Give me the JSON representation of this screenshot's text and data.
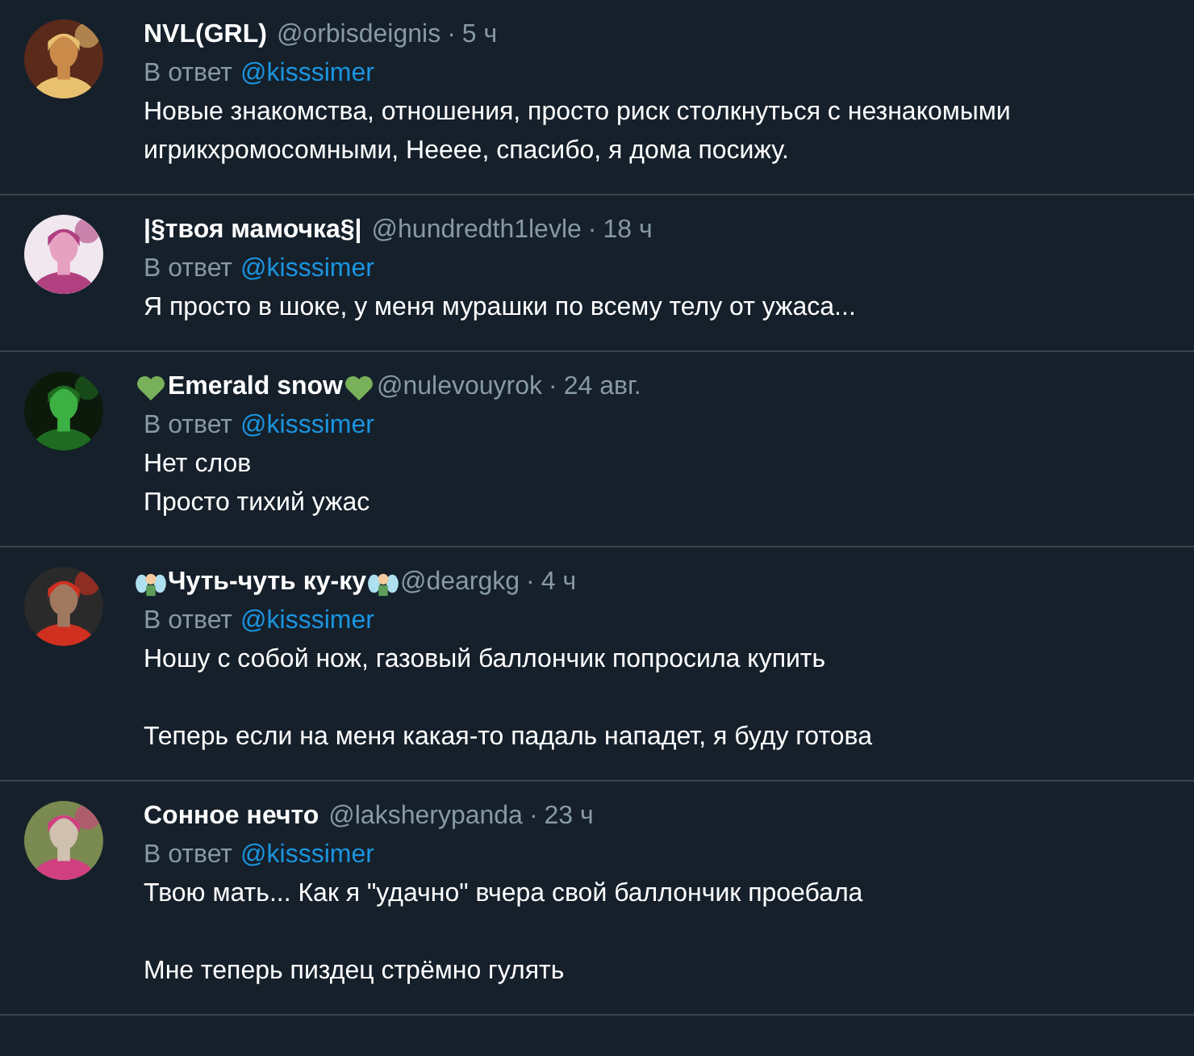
{
  "replies": [
    {
      "kind": "plain",
      "name": "NVL(GRL)",
      "handle": "@orbisdeignis",
      "separator": "·",
      "time": "5 ч",
      "reply_label": "В ответ",
      "reply_to": "@kisssimer",
      "blocks": [
        {
          "lines": [
            "Новые знакомства, отношения, просто риск столкнуться с незнакомыми игрикхромосомными, Нееее, спасибо, я дома посижу."
          ]
        }
      ]
    },
    {
      "kind": "plain",
      "name": "|§твоя мамочка§|",
      "handle": "@hundredth1levle",
      "separator": "·",
      "time": "18 ч",
      "reply_label": "В ответ",
      "reply_to": "@kisssimer",
      "blocks": [
        {
          "lines": [
            "Я просто в шоке, у меня мурашки по всему телу от ужаса..."
          ]
        }
      ]
    },
    {
      "kind": "heart",
      "name": "Emerald snow",
      "handle": "@nulevouyrok",
      "separator": "·",
      "time": "24 авг.",
      "reply_label": "В ответ",
      "reply_to": "@kisssimer",
      "blocks": [
        {
          "lines": [
            "Нет слов",
            "Просто тихий ужас"
          ]
        }
      ]
    },
    {
      "kind": "fairy",
      "name": "Чуть-чуть ку-ку",
      "handle": "@deargkg",
      "separator": "·",
      "time": "4 ч",
      "reply_label": "В ответ",
      "reply_to": "@kisssimer",
      "blocks": [
        {
          "lines": [
            "Ношу с собой нож, газовый баллончик попросила купить"
          ]
        },
        {
          "lines": [
            "Теперь если на меня какая-то падаль нападет, я буду готова"
          ]
        }
      ]
    },
    {
      "kind": "plain",
      "name": "Сонное нечто",
      "handle": "@laksherypanda",
      "separator": "·",
      "time": "23 ч",
      "reply_label": "В ответ",
      "reply_to": "@kisssimer",
      "blocks": [
        {
          "lines": [
            "Твою мать... Как я \"удачно\" вчера свой баллончик проебала"
          ]
        },
        {
          "lines": [
            "Мне теперь пиздец стрёмно гулять"
          ]
        }
      ]
    }
  ]
}
